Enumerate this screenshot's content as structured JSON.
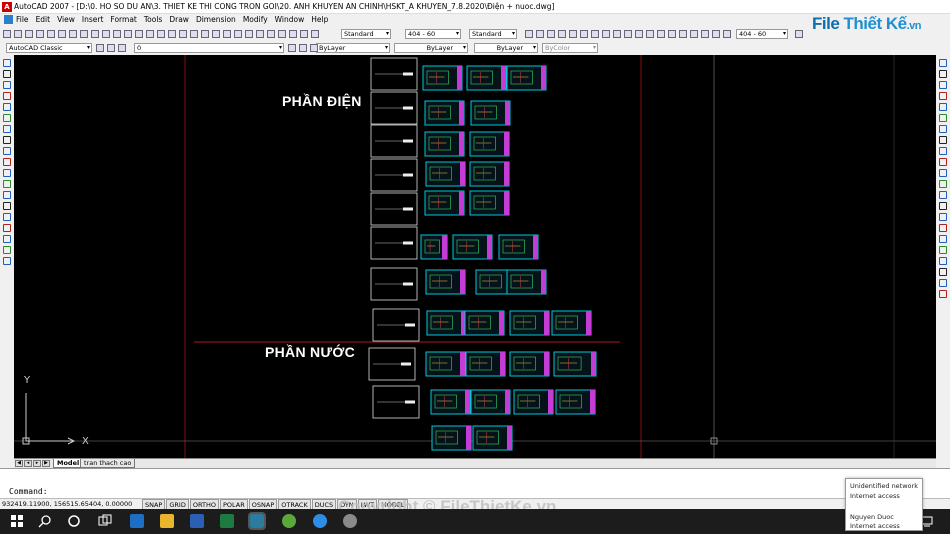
{
  "window": {
    "title": "AutoCAD 2007 - [D:\\0. HO SO DU AN\\3. THIET KE THI CONG TRON GOI\\20. ANH KHUYEN AN CHINH\\HSKT_A KHUYEN_7.8.2020\\Điện + nuoc.dwg]"
  },
  "menu": {
    "items": [
      "File",
      "Edit",
      "View",
      "Insert",
      "Format",
      "Tools",
      "Draw",
      "Dimension",
      "Modify",
      "Window",
      "Help"
    ]
  },
  "toolbar": {
    "text_style": "Standard",
    "dim_style": "404 - 60",
    "table_style": "Standard",
    "ml_style": "404 - 60",
    "workspace": "AutoCAD Classic",
    "layer": "0",
    "color": "ByLayer",
    "linetype": "ByLayer",
    "lineweight": "ByLayer",
    "plotstyle": "ByColor"
  },
  "logo": {
    "part1": "File",
    "part2": "Thiết Kế",
    "part3": ".vn"
  },
  "drawing": {
    "section_electric": "PHẦN ĐIỆN",
    "section_water": "PHẦN NƯỚC",
    "ucs_x": "X",
    "ucs_y": "Y"
  },
  "layout_tabs": {
    "model": "Model",
    "layout1": "tran thach cao"
  },
  "command": {
    "prompt": "Command:"
  },
  "status": {
    "coords": "932419.11900, 156515.65404, 0.00000",
    "toggles": [
      "SNAP",
      "GRID",
      "ORTHO",
      "POLAR",
      "OSNAP",
      "OTRACK",
      "DUCS",
      "DYN",
      "LWT",
      "MODEL"
    ]
  },
  "watermark": "Copyright © FileThietKe.vn",
  "network_popup": {
    "line1": "Unidentified network",
    "line2": "Internet access",
    "line3": "Nguyen Duoc",
    "line4": "Internet access"
  },
  "colors": {
    "canvas": "#000000",
    "sheet_cyan": "#00c8d8",
    "sheet_magenta": "#c43cd6",
    "red_line": "#b01818"
  }
}
